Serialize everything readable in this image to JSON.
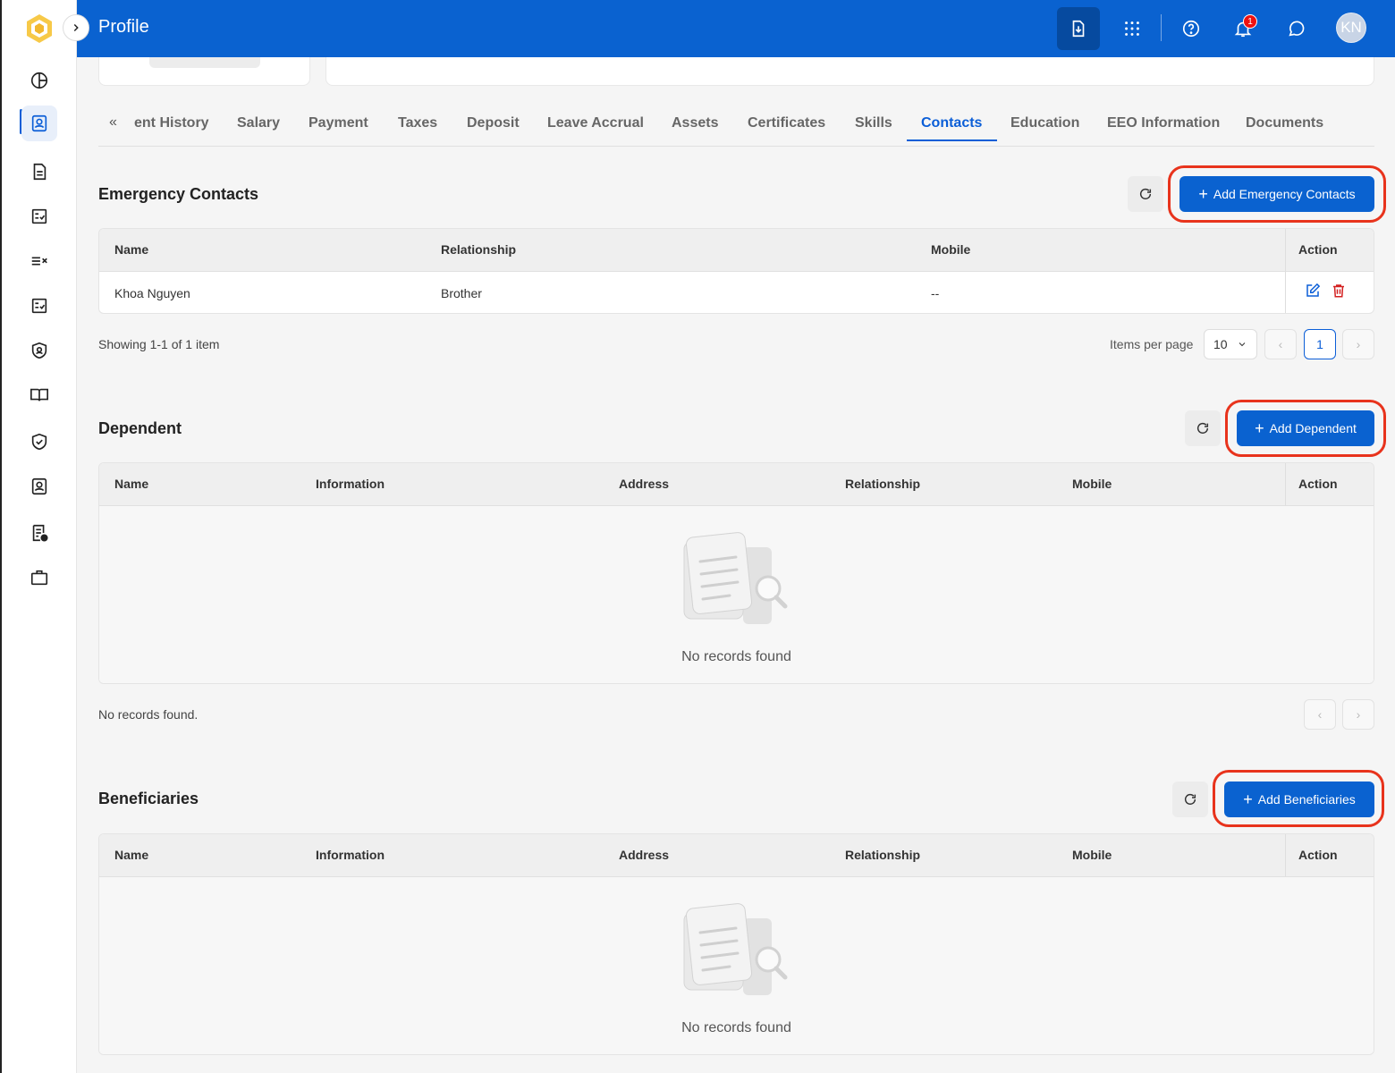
{
  "header": {
    "title": "Profile",
    "notification_count": "1",
    "avatar_initials": "KN"
  },
  "sidebar": {
    "items": [
      "dashboard",
      "profile",
      "documents",
      "tasks",
      "checklist",
      "approvals",
      "security",
      "handbook",
      "compliance",
      "directory",
      "reports",
      "jobs"
    ]
  },
  "tabs": {
    "items": [
      "ent History",
      "Salary",
      "Payment",
      "Taxes",
      "Deposit",
      "Leave Accrual",
      "Assets",
      "Certificates",
      "Skills",
      "Contacts",
      "Education",
      "EEO Information",
      "Documents"
    ],
    "active": "Contacts"
  },
  "emergency": {
    "title": "Emergency Contacts",
    "add_label": "Add Emergency Contacts",
    "columns": [
      "Name",
      "Relationship",
      "Mobile",
      "Action"
    ],
    "rows": [
      {
        "name": "Khoa Nguyen",
        "relationship": "Brother",
        "mobile": "--"
      }
    ],
    "summary": "Showing 1-1 of 1 item",
    "items_per_page_label": "Items per page",
    "items_per_page": "10",
    "current_page": "1"
  },
  "dependent": {
    "title": "Dependent",
    "add_label": "Add Dependent",
    "columns": [
      "Name",
      "Information",
      "Address",
      "Relationship",
      "Mobile",
      "Action"
    ],
    "empty_text": "No records found",
    "footer_text": "No records found."
  },
  "beneficiaries": {
    "title": "Beneficiaries",
    "add_label": "Add Beneficiaries",
    "columns": [
      "Name",
      "Information",
      "Address",
      "Relationship",
      "Mobile",
      "Action"
    ],
    "empty_text": "No records found"
  },
  "colors": {
    "primary": "#0a62d0",
    "highlight": "#e8331c",
    "delete": "#d32020"
  }
}
